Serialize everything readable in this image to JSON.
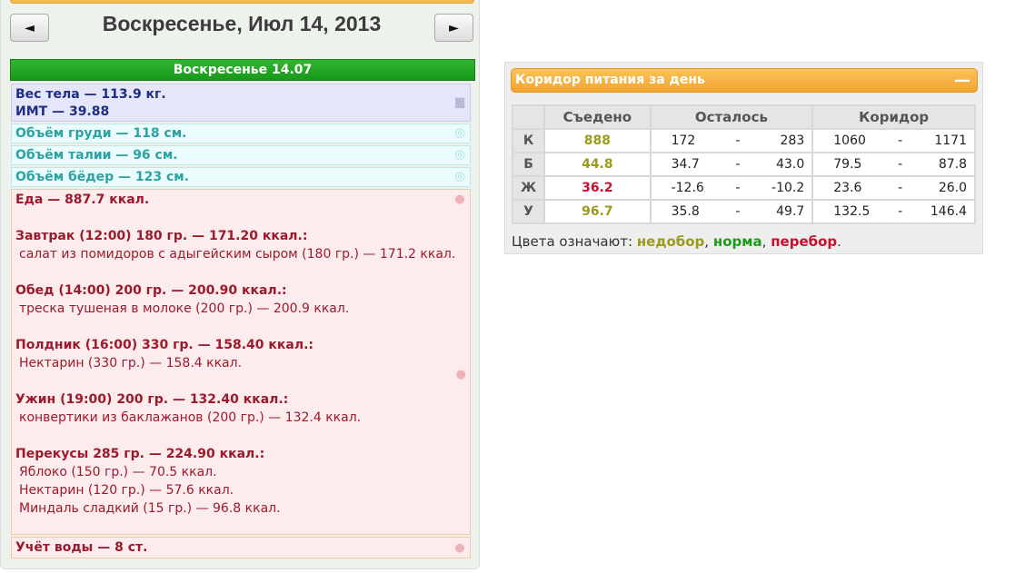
{
  "diary": {
    "prev_label": "◄",
    "next_label": "►",
    "date_title": "Воскресенье, Июл 14, 2013",
    "day_header": "Воскресенье 14.07",
    "weight_line": "Вес тела — 113.9 кг.",
    "bmi_line": "ИМТ — 39.88",
    "chest": "Объём груди — 118 см.",
    "waist": "Объём талии — 96 см.",
    "hips": "Объём бёдер — 123 см.",
    "food_total": "Еда — 887.7 ккал.",
    "meals": [
      {
        "title": "Завтрак (12:00) 180 гр. — 171.20 ккал.:",
        "items": [
          "салат из помидоров с адыгейским сыром (180 гр.) — 171.2 ккал."
        ]
      },
      {
        "title": "Обед (14:00) 200 гр. — 200.90 ккал.:",
        "items": [
          "треска тушеная в молоке (200 гр.) — 200.9 ккал."
        ]
      },
      {
        "title": "Полдник (16:00) 330 гр. — 158.40 ккал.:",
        "items": [
          "Нектарин (330 гр.) — 158.4 ккал."
        ]
      },
      {
        "title": "Ужин (19:00) 200 гр. — 132.40 ккал.:",
        "items": [
          "конвертики из баклажанов (200 гр.) — 132.4 ккал."
        ]
      },
      {
        "title": "Перекусы 285 гр. — 224.90 ккал.:",
        "items": [
          "Яблоко (150 гр.) — 70.5 ккал.",
          "Нектарин (120 гр.) — 57.6 ккал.",
          "Миндаль сладкий (15 гр.) — 96.8 ккал."
        ]
      }
    ],
    "water": "Учёт воды — 8 ст."
  },
  "nutrition": {
    "header": "Коридор питания за день",
    "toggle": "—",
    "columns": [
      "Съедено",
      "Осталось",
      "Коридор"
    ],
    "dash": "-",
    "rows": [
      {
        "label": "К",
        "eaten": "888",
        "eaten_color": "olive",
        "left_from": "172",
        "left_to": "283",
        "corr_from": "1060",
        "corr_to": "1171"
      },
      {
        "label": "Б",
        "eaten": "44.8",
        "eaten_color": "olive",
        "left_from": "34.7",
        "left_to": "43.0",
        "corr_from": "79.5",
        "corr_to": "87.8"
      },
      {
        "label": "Ж",
        "eaten": "36.2",
        "eaten_color": "red",
        "left_from": "-12.6",
        "left_to": "-10.2",
        "corr_from": "23.6",
        "corr_to": "26.0"
      },
      {
        "label": "У",
        "eaten": "96.7",
        "eaten_color": "olive",
        "left_from": "35.8",
        "left_to": "49.7",
        "corr_from": "132.5",
        "corr_to": "146.4"
      }
    ],
    "legend_prefix": "Цвета означают: ",
    "legend_under": "недобор",
    "legend_norm": "норма",
    "legend_over": "перебор",
    "legend_sep": ", ",
    "legend_end": ".",
    "colors": {
      "olive": "#9b9a1b",
      "green": "#1c9a1c",
      "red": "#c8102e"
    }
  }
}
